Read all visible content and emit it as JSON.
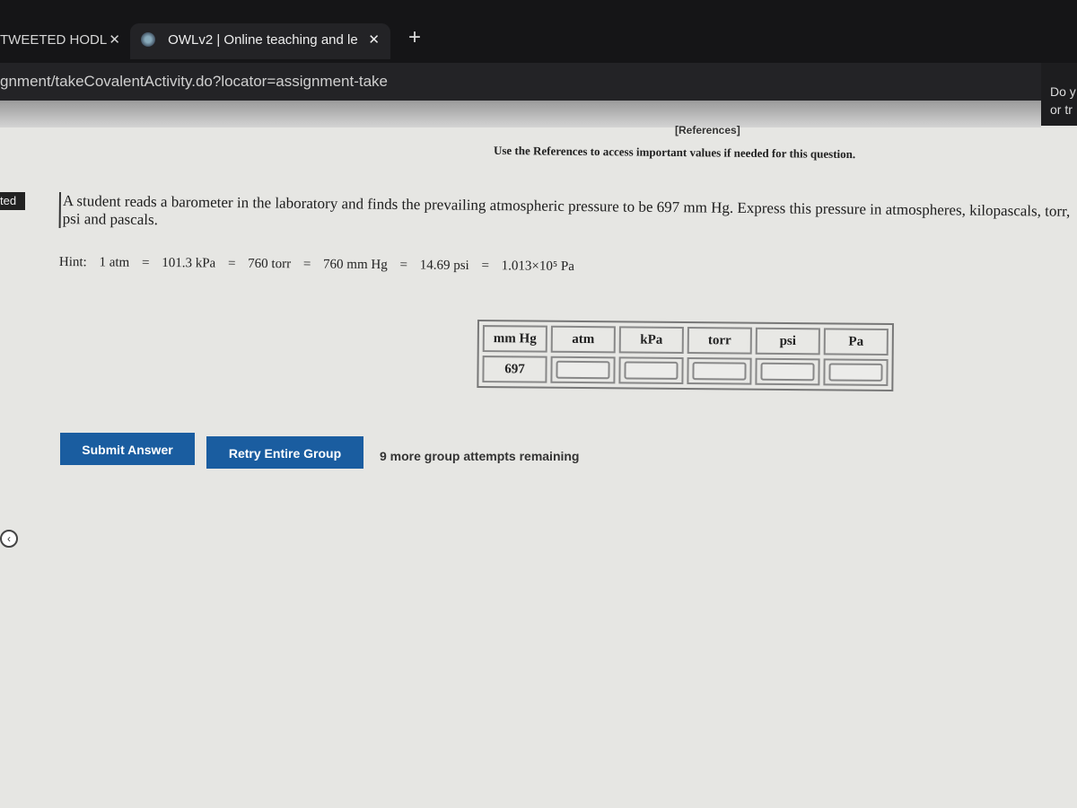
{
  "browser": {
    "tabs": [
      {
        "label": "TWEETED HODL",
        "close": "✕"
      },
      {
        "label": "OWLv2 | Online teaching and le",
        "close": "✕",
        "active": true
      }
    ],
    "new_tab": "+",
    "url": "gnment/takeCovalentActivity.do?locator=assignment-take",
    "side_text": [
      "Do y",
      "or tr"
    ]
  },
  "left_edge_label": "ted",
  "references_link": "[References]",
  "references_note": "Use the References to access important values if needed for this question.",
  "question": "A student reads a barometer in the laboratory and finds the prevailing atmospheric pressure to be 697 mm Hg. Express this pressure in atmospheres, kilopascals, torr, psi and pascals.",
  "hint": {
    "label": "Hint:",
    "parts": [
      "1 atm",
      "=",
      "101.3 kPa",
      "=",
      "760 torr",
      "=",
      "760 mm Hg",
      "=",
      "14.69 psi",
      "=",
      "1.013×10⁵ Pa"
    ]
  },
  "table": {
    "headers": [
      "mm Hg",
      "atm",
      "kPa",
      "torr",
      "psi",
      "Pa"
    ],
    "given_value": "697",
    "inputs": [
      "",
      "",
      "",
      "",
      ""
    ]
  },
  "buttons": {
    "submit": "Submit Answer",
    "retry": "Retry Entire Group"
  },
  "attempts_text": "9 more group attempts remaining",
  "colors": {
    "button": "#1a5da0",
    "topbar": "#151517"
  }
}
